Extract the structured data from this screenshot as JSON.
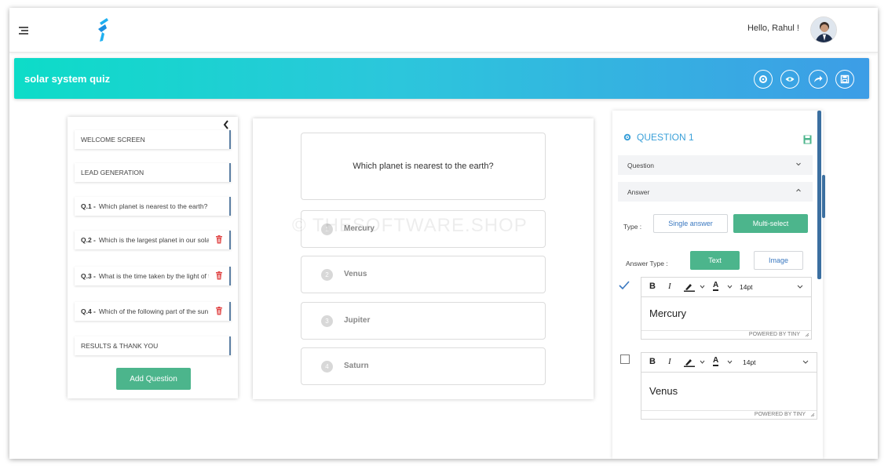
{
  "header": {
    "greeting": "Hello, Rahul !"
  },
  "quiz": {
    "title": "solar system quiz",
    "actions": [
      "settings-icon",
      "eye-icon",
      "share-icon",
      "save-icon"
    ]
  },
  "sidebar": {
    "items": [
      {
        "num": "",
        "label": "WELCOME SCREEN",
        "deletable": false
      },
      {
        "num": "",
        "label": "LEAD GENERATION",
        "deletable": false
      },
      {
        "num": "Q.1 -",
        "label": "Which planet is nearest to the earth?",
        "deletable": false
      },
      {
        "num": "Q.2 -",
        "label": "Which is the largest planet in our solar system?",
        "deletable": true
      },
      {
        "num": "Q.3 -",
        "label": "What is the time taken by the light of the sun to reach the earth?",
        "deletable": true
      },
      {
        "num": "Q.4 -",
        "label": "Which of the following part of the sun is visible?",
        "deletable": true
      },
      {
        "num": "",
        "label": "RESULTS & THANK YOU",
        "deletable": false
      }
    ],
    "add_label": "Add Question"
  },
  "preview": {
    "question": "Which planet is nearest to the earth?",
    "answers": [
      {
        "num": "1",
        "label": "Mercury"
      },
      {
        "num": "2",
        "label": "Venus"
      },
      {
        "num": "3",
        "label": "Jupiter"
      },
      {
        "num": "4",
        "label": "Saturn"
      }
    ],
    "watermark": "© THESOFTWARE.SHOP"
  },
  "editor_panel": {
    "title": "QUESTION 1",
    "question_section": "Question",
    "answer_section": "Answer",
    "type_label": "Type :",
    "type_options": [
      "Single answer",
      "Multi-select"
    ],
    "type_selected": "Multi-select",
    "answer_type_label": "Answer Type :",
    "answer_type_options": [
      "Text",
      "Image"
    ],
    "answer_type_selected": "Text",
    "font_size": "14pt",
    "powered_by": "POWERED BY TINY",
    "answers": [
      {
        "text": "Mercury",
        "checked": true
      },
      {
        "text": "Venus",
        "checked": false
      }
    ]
  },
  "colors": {
    "accent_green": "#4cb58c",
    "accent_blue": "#3aa0d9",
    "gradient_start": "#0ddcc8",
    "gradient_end": "#3d9de6"
  }
}
